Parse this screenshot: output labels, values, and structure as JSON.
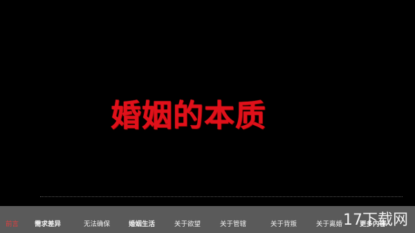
{
  "video": {
    "title": "婚姻的本质"
  },
  "nav": {
    "items": [
      {
        "label": "前言",
        "active": true
      },
      {
        "label": "需求差异",
        "active": false
      },
      {
        "label": "无法确保",
        "active": false
      },
      {
        "label": "婚姻生活",
        "active": false
      },
      {
        "label": "关于欲望",
        "active": false
      },
      {
        "label": "关于管辖",
        "active": false
      },
      {
        "label": "关于背叛",
        "active": false
      },
      {
        "label": "关于离婚",
        "active": false
      },
      {
        "label": "更多内容",
        "active": false
      }
    ]
  },
  "watermark": {
    "text": "17下载网"
  },
  "colors": {
    "title": "#e0101a",
    "nav_background": "#5a5a5a",
    "nav_text": "#f2f2f2",
    "active_item": "#e04040"
  }
}
